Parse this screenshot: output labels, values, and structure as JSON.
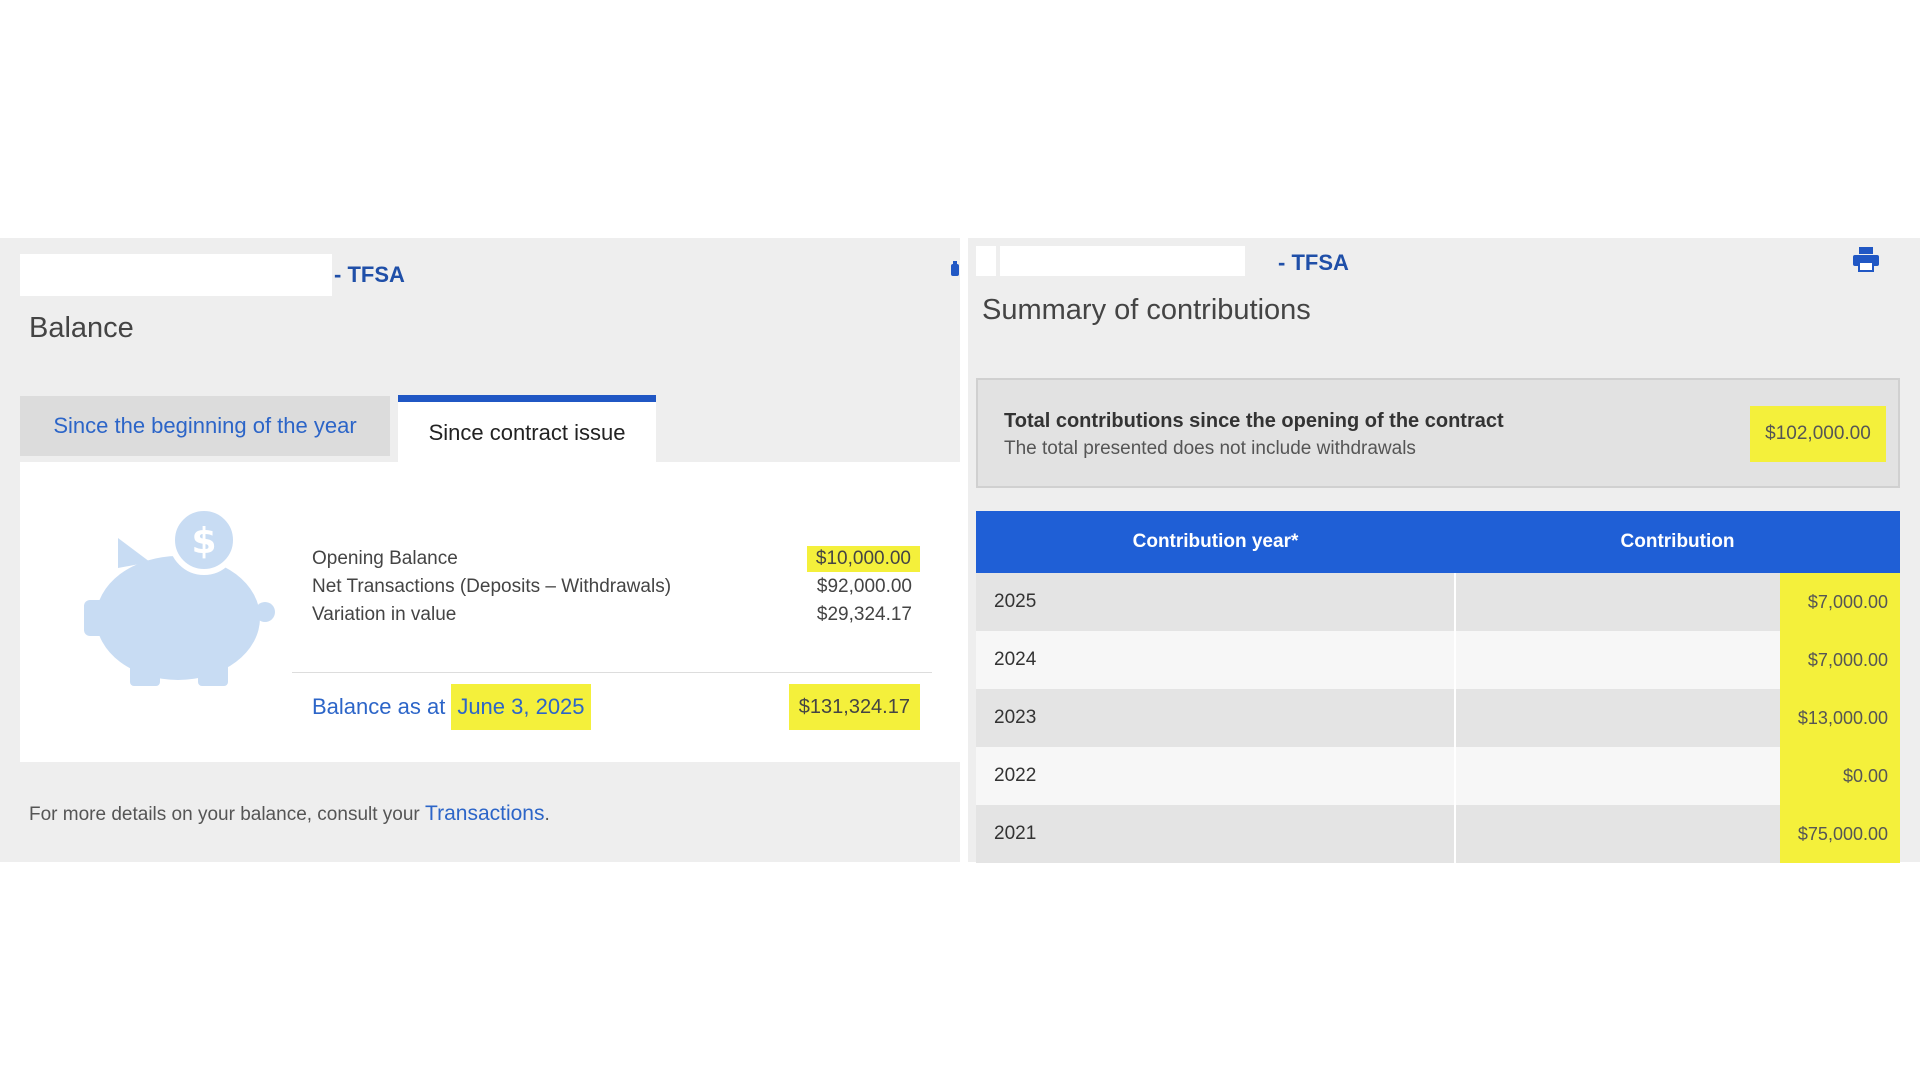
{
  "left_panel": {
    "account_suffix": "- TFSA",
    "title": "Balance",
    "tabs": [
      {
        "label": "Since the beginning of the year",
        "active": false
      },
      {
        "label": "Since contract issue",
        "active": true
      }
    ],
    "balance_rows": [
      {
        "label": "Opening Balance",
        "value": "$10,000.00",
        "highlighted": true
      },
      {
        "label": "Net Transactions (Deposits – Withdrawals)",
        "value": "$92,000.00",
        "highlighted": false
      },
      {
        "label": "Variation in value",
        "value": "$29,324.17",
        "highlighted": false
      }
    ],
    "balance_as_at_label": "Balance as at",
    "balance_date": "June 3, 2025",
    "balance_total": "$131,324.17",
    "footer_text": "For more details on your balance, consult your",
    "footer_link": "Transactions",
    "footer_end": ".",
    "icons": {
      "piggy": "piggy-bank-icon",
      "clip": "attachment-icon"
    }
  },
  "right_panel": {
    "account_suffix": "- TFSA",
    "title": "Summary of contributions",
    "total_label": "Total contributions since the opening of the contract",
    "total_note": "The total presented does not include withdrawals",
    "total_value": "$102,000.00",
    "table": {
      "headers": [
        "Contribution year*",
        "Contribution"
      ],
      "rows": [
        {
          "year": "2025",
          "amount": "$7,000.00"
        },
        {
          "year": "2024",
          "amount": "$7,000.00"
        },
        {
          "year": "2023",
          "amount": "$13,000.00"
        },
        {
          "year": "2022",
          "amount": "$0.00"
        },
        {
          "year": "2021",
          "amount": "$75,000.00"
        }
      ]
    },
    "icons": {
      "print": "print-icon"
    }
  },
  "colors": {
    "accent_blue": "#2057c4",
    "link_blue": "#2c65c8",
    "table_header": "#1f5fd6",
    "highlight": "#f4f03b",
    "panel_bg": "#eeeeee"
  }
}
